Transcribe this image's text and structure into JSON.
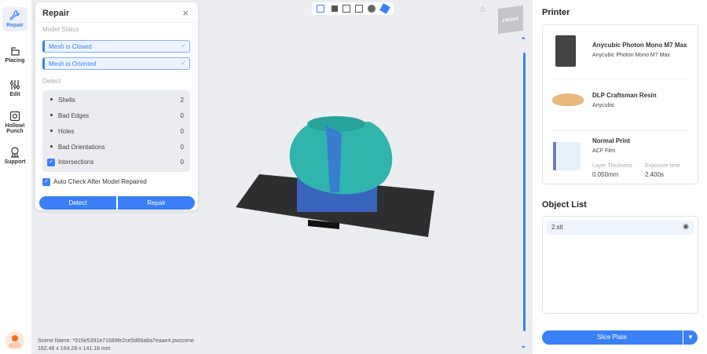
{
  "sidebar": {
    "items": [
      {
        "label": "Repair"
      },
      {
        "label": "Placing"
      },
      {
        "label": "Edit"
      },
      {
        "label": "Hollow\\ Punch"
      },
      {
        "label": "Support"
      }
    ]
  },
  "repair_panel": {
    "title": "Repair",
    "model_status_label": "Model Status",
    "statuses": [
      "Mesh is Closed",
      "Mesh is Oriented"
    ],
    "detect_label": "Detect",
    "detect_rows": [
      {
        "label": "Shells",
        "value": "2"
      },
      {
        "label": "Bad Edges",
        "value": "0"
      },
      {
        "label": "Holes",
        "value": "0"
      },
      {
        "label": "Bad Orientations",
        "value": "0"
      },
      {
        "label": "Intersections",
        "value": "0",
        "checked": true
      }
    ],
    "auto_check_label": "Auto Check After Model Repaired",
    "detect_button": "Detect",
    "repair_button": "Repair"
  },
  "viewport": {
    "view_cube_label": "FRONT",
    "scene_name": "Scene Name: *915e5391e71689fe2ce5d66a8a7eaae4.pwscene",
    "dimensions": "162.46 x 164.28 x 141.16 mm"
  },
  "printer": {
    "title": "Printer",
    "machine_name": "Anycubic Photon Mono M7 Max",
    "machine_sub": "Anycubic Photon Mono M7 Max",
    "resin_name": "DLP Craftsman Resin",
    "resin_brand": "Anycubic",
    "profile_name": "Normal Print",
    "film": "ACF Film",
    "layer_thickness_label": "Layer Thickness",
    "layer_thickness": "0.050mm",
    "exposure_label": "Exposure time",
    "exposure": "2.400s"
  },
  "object_list": {
    "title": "Object List",
    "items": [
      {
        "name": "2.stl"
      }
    ]
  },
  "slice_button": "Slice Plate",
  "colors": {
    "accent": "#3a7ff5",
    "model": "#2fb5ad",
    "support": "#3b6fd8"
  }
}
